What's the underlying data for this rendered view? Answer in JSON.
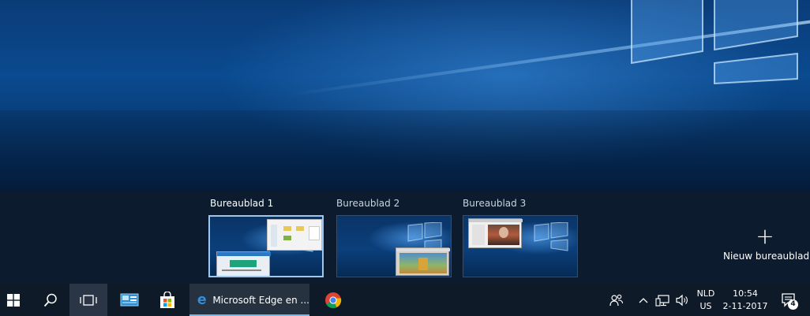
{
  "task_view": {
    "desktops": [
      {
        "label": "Bureaublad 1",
        "active": true
      },
      {
        "label": "Bureaublad 2",
        "active": false
      },
      {
        "label": "Bureaublad 3",
        "active": false
      }
    ],
    "new_desktop": {
      "icon": "plus-icon",
      "label": "Nieuw bureaublad"
    }
  },
  "taskbar": {
    "start_icon": "windows-logo-icon",
    "search_icon": "search-icon",
    "task_view_icon": "task-view-icon",
    "pinned": [
      {
        "icon": "control-panel-icon"
      },
      {
        "icon": "store-icon"
      },
      {
        "icon": "edge-icon",
        "title": "Microsoft Edge en ..."
      },
      {
        "icon": "chrome-icon"
      }
    ],
    "tray": {
      "people_icon": "people-icon",
      "chevron_icon": "chevron-up-icon",
      "network_icon": "network-icon",
      "volume_icon": "volume-icon",
      "language": "NLD",
      "layout": "US",
      "time": "10:54",
      "date": "2-11-2017",
      "notification_icon": "action-center-icon",
      "notification_count": "4"
    }
  },
  "colors": {
    "taskbar_bg": "#0e1a27",
    "taskview_bg": "#0c1b2e",
    "accent": "#76b9ed"
  }
}
